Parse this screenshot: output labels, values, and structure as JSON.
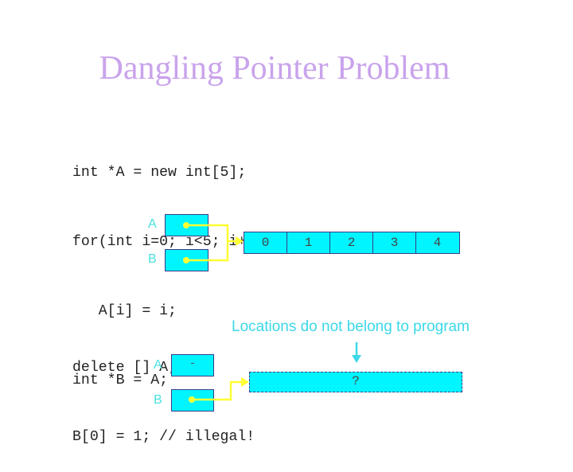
{
  "slide": {
    "title": "Dangling Pointer Problem",
    "code_top": [
      "int *A = new int[5];",
      "for(int i=0; i<5; i++)",
      "   A[i] = i;",
      "int *B = A;"
    ],
    "diagram_before": {
      "pointer_labels": [
        "A",
        "B"
      ],
      "array_values": [
        "0",
        "1",
        "2",
        "3",
        "4"
      ]
    },
    "code_bottom": [
      "delete [] A;",
      "B[0] = 1; // illegal!"
    ],
    "annotation": "Locations do not belong to program",
    "diagram_after": {
      "pointer_labels": [
        "A",
        "B"
      ],
      "a_value": "-",
      "freed_value": "?"
    },
    "colors": {
      "title": "#c9a3ec",
      "box_fill": "#00f5ff",
      "arrow": "#ffff33",
      "label": "#48e0e0"
    }
  }
}
